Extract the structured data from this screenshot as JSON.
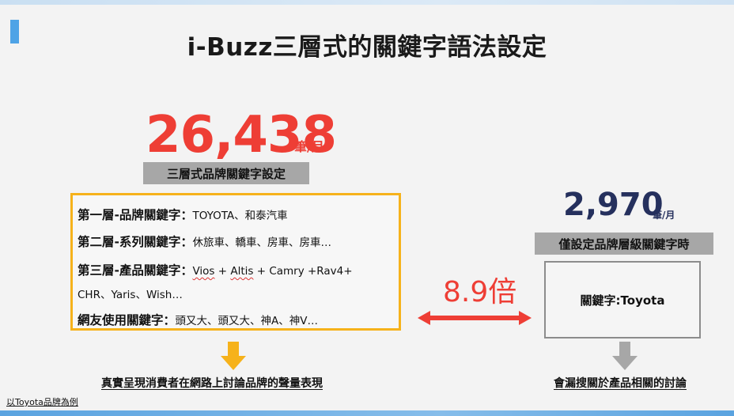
{
  "title": "i-Buzz三層式的關鍵字語法設定",
  "left": {
    "big_number": "26,438",
    "unit": "筆/月",
    "label": "三層式品牌關鍵字設定",
    "rows": [
      {
        "head": "第一層-品牌關鍵字",
        "sep": "：",
        "text": "TOYOTA、和泰汽車"
      },
      {
        "head": "第二層-系列關鍵字",
        "sep": "：",
        "text": "休旅車、轎車、房車、房車…"
      },
      {
        "head": "第三層-產品關鍵字",
        "sep": "：",
        "text_a": "Vios",
        "text_b": " + ",
        "text_c": "Altis",
        "text_d": " + Camry +Rav4+"
      },
      {
        "text": "CHR、Yaris、Wish…"
      },
      {
        "head": "網友使用關鍵字",
        "sep": "：",
        "text": "頭又大、頭又大、神A、神V…"
      }
    ],
    "caption": "真實呈現消費者在網路上討論品牌的聲量表現"
  },
  "ratio": "8.9倍",
  "right": {
    "big_number": "2,970",
    "unit": "筆/月",
    "label": "僅設定品牌層級關鍵字時",
    "box_text": "關鍵字:Toyota",
    "caption": "會漏搜關於產品相關的討論"
  },
  "footnote": "以Toyota品牌為例",
  "colors": {
    "accent_blue": "#4ea3e6",
    "red": "#ee3e35",
    "navy": "#25305d",
    "orange": "#f6b21b",
    "arrow_yellow": "#f6b21b",
    "arrow_gray": "#a7a7a7"
  }
}
